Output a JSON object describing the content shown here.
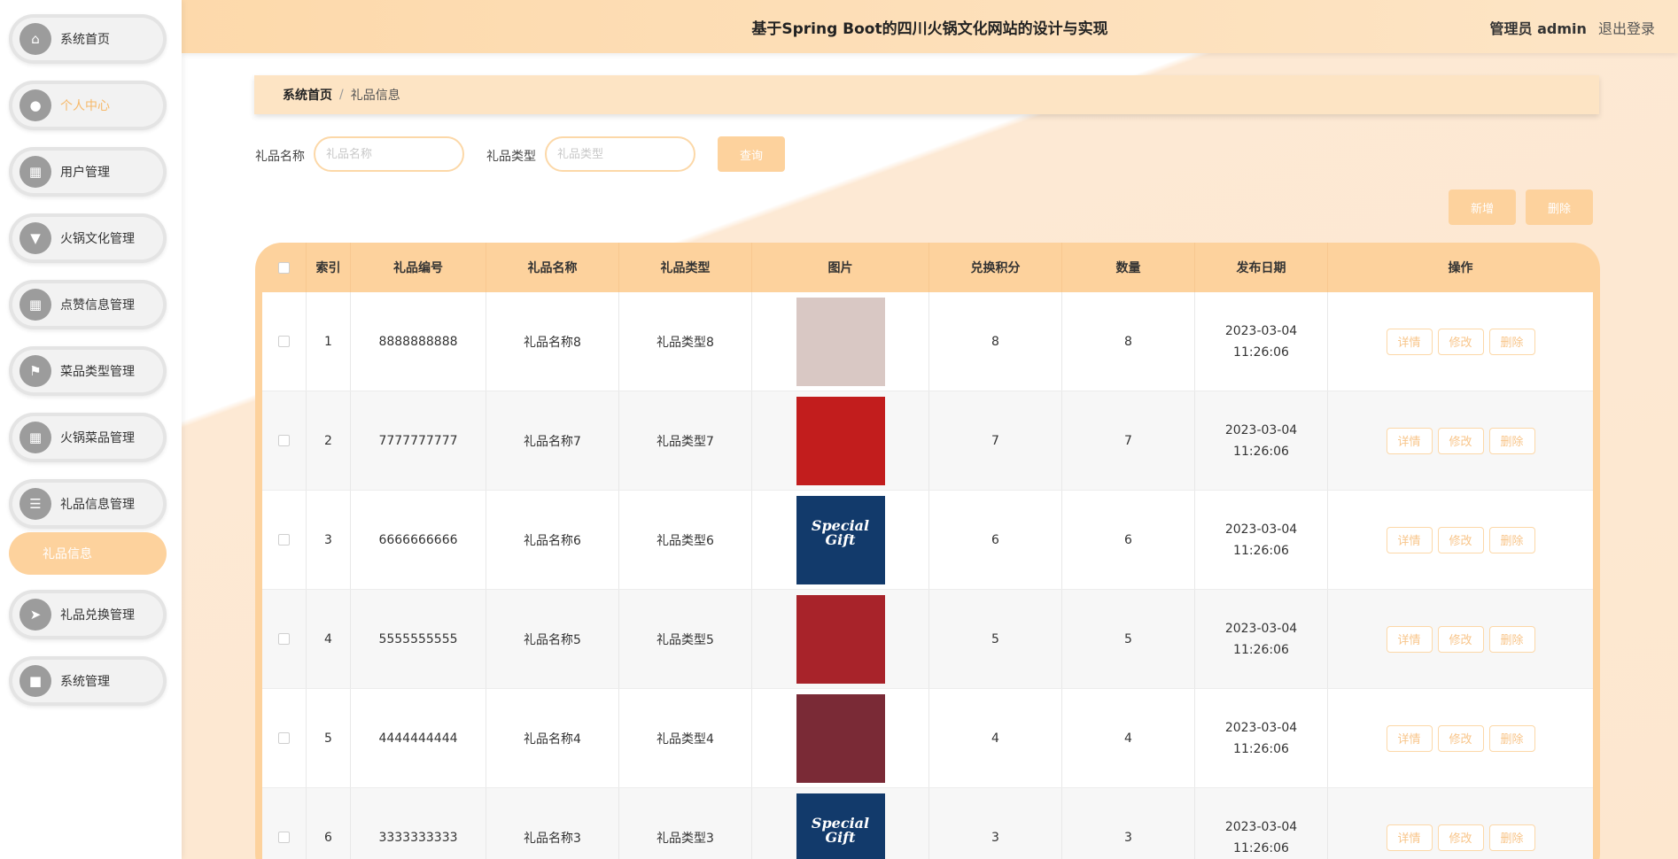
{
  "app": {
    "title": "基于Spring Boot的四川火锅文化网站的设计与实现",
    "user_label": "管理员 admin",
    "logout": "退出登录"
  },
  "sidebar": {
    "items": [
      {
        "label": "系统首页",
        "icon": "home-icon",
        "glyph": "⌂"
      },
      {
        "label": "个人中心",
        "icon": "person-icon",
        "glyph": "●"
      },
      {
        "label": "用户管理",
        "icon": "grid-icon",
        "glyph": "▦"
      },
      {
        "label": "火锅文化管理",
        "icon": "pin-icon",
        "glyph": "▼"
      },
      {
        "label": "点赞信息管理",
        "icon": "apps-icon",
        "glyph": "▦"
      },
      {
        "label": "菜品类型管理",
        "icon": "flag-icon",
        "glyph": "⚑"
      },
      {
        "label": "火锅菜品管理",
        "icon": "apps-icon",
        "glyph": "▦"
      },
      {
        "label": "礼品信息管理",
        "icon": "list-icon",
        "glyph": "☰"
      },
      {
        "label": "礼品兑换管理",
        "icon": "send-icon",
        "glyph": "➤"
      },
      {
        "label": "系统管理",
        "icon": "briefcase-icon",
        "glyph": "■"
      }
    ],
    "subitem": "礼品信息"
  },
  "breadcrumb": {
    "home": "系统首页",
    "sep": "/",
    "current": "礼品信息"
  },
  "search": {
    "name_label": "礼品名称",
    "name_placeholder": "礼品名称",
    "type_label": "礼品类型",
    "type_placeholder": "礼品类型",
    "query": "查询"
  },
  "actions": {
    "add": "新增",
    "delete": "删除"
  },
  "table": {
    "headers": [
      "索引",
      "礼品编号",
      "礼品名称",
      "礼品类型",
      "图片",
      "兑换积分",
      "数量",
      "发布日期",
      "操作"
    ],
    "op_labels": {
      "detail": "详情",
      "edit": "修改",
      "remove": "删除"
    },
    "rows": [
      {
        "index": "1",
        "code": "8888888888",
        "name": "礼品名称8",
        "type": "礼品类型8",
        "points": "8",
        "qty": "8",
        "date": "2023-03-04 11:26:06",
        "img_bg": "#d9c8c4",
        "img_text": ""
      },
      {
        "index": "2",
        "code": "7777777777",
        "name": "礼品名称7",
        "type": "礼品类型7",
        "points": "7",
        "qty": "7",
        "date": "2023-03-04 11:26:06",
        "img_bg": "#c21d1d",
        "img_text": ""
      },
      {
        "index": "3",
        "code": "6666666666",
        "name": "礼品名称6",
        "type": "礼品类型6",
        "points": "6",
        "qty": "6",
        "date": "2023-03-04 11:26:06",
        "img_bg": "#123a6b",
        "img_text": "Special Gift"
      },
      {
        "index": "4",
        "code": "5555555555",
        "name": "礼品名称5",
        "type": "礼品类型5",
        "points": "5",
        "qty": "5",
        "date": "2023-03-04 11:26:06",
        "img_bg": "#a8232a",
        "img_text": ""
      },
      {
        "index": "5",
        "code": "4444444444",
        "name": "礼品名称4",
        "type": "礼品类型4",
        "points": "4",
        "qty": "4",
        "date": "2023-03-04 11:26:06",
        "img_bg": "#7a2a36",
        "img_text": ""
      },
      {
        "index": "6",
        "code": "3333333333",
        "name": "礼品名称3",
        "type": "礼品类型3",
        "points": "3",
        "qty": "3",
        "date": "2023-03-04 11:26:06",
        "img_bg": "#123a6b",
        "img_text": "Special Gift"
      }
    ]
  }
}
